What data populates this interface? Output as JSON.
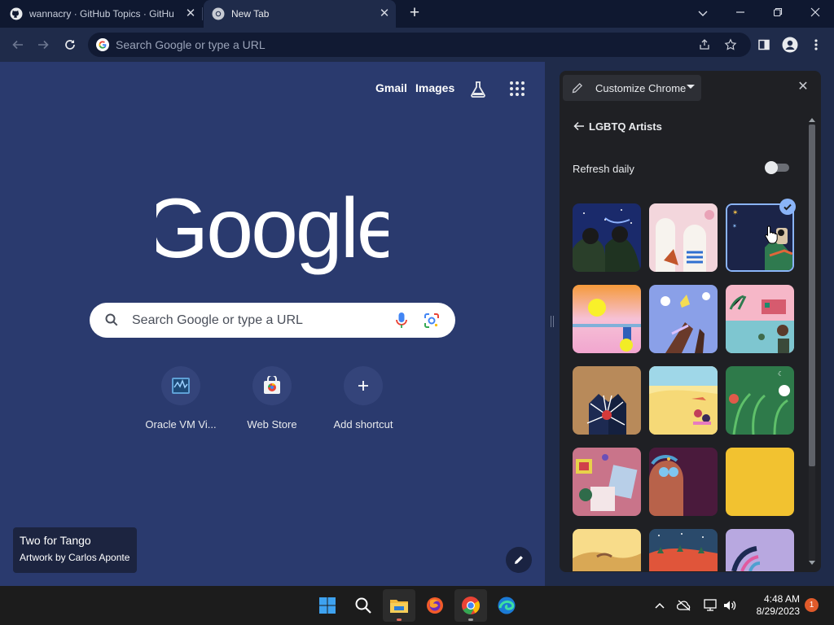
{
  "tabs": [
    {
      "title": "wannacry · GitHub Topics · GitHub",
      "icon": "github-icon",
      "active": false
    },
    {
      "title": "New Tab",
      "icon": "chrome-icon",
      "active": true
    }
  ],
  "window_controls": [
    "tab-search-icon",
    "minimize-icon",
    "restore-icon",
    "close-icon"
  ],
  "toolbar": {
    "omnibox_placeholder": "Search Google or type a URL"
  },
  "ntp": {
    "links": {
      "gmail": "Gmail",
      "images": "Images"
    },
    "search_placeholder": "Search Google or type a URL",
    "shortcuts": [
      {
        "label": "Oracle VM Vi...",
        "icon": "virtualbox-icon"
      },
      {
        "label": "Web Store",
        "icon": "web-store-icon"
      },
      {
        "label": "Add shortcut",
        "icon": "plus-icon"
      }
    ],
    "attribution": {
      "title": "Two for Tango",
      "artist": "Artwork by Carlos Aponte"
    }
  },
  "panel": {
    "dropdown_label": "Customize Chrome",
    "collection_title": "LGBTQ Artists",
    "refresh_label": "Refresh daily",
    "refresh_enabled": false,
    "selected_index": 2,
    "thumbnails": [
      "couple-night-sky",
      "pink-arches",
      "night-figure-selected",
      "sunset-lake",
      "butterflies-hands",
      "pink-pool-palms",
      "hugging-couple-burst",
      "beach-figures",
      "green-leaves",
      "collage-papers",
      "portrait-sunglasses",
      "solid-yellow",
      "yellow-dunes",
      "desert-night",
      "lavender-wave"
    ]
  },
  "taskbar": {
    "apps": [
      "windows-start-icon",
      "search-icon",
      "file-explorer-icon",
      "firefox-icon",
      "chrome-icon",
      "edge-icon"
    ],
    "time": "4:48 AM",
    "date": "8/29/2023",
    "notification_count": "1"
  },
  "colors": {
    "ntp_background": "#2a3a6e",
    "panel_background": "#1f2024",
    "accent": "#8ab4f8"
  }
}
